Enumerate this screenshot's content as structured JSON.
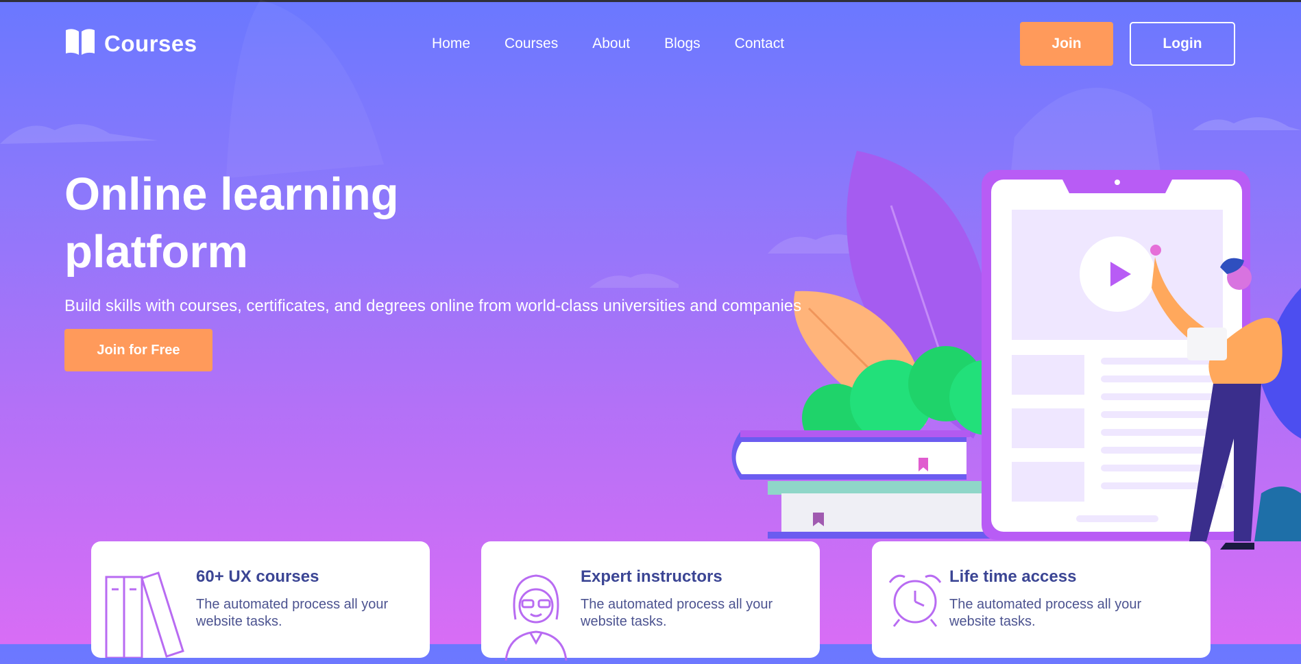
{
  "brand": {
    "name": "Courses",
    "icon": "open-book-icon"
  },
  "nav": {
    "items": [
      "Home",
      "Courses",
      "About",
      "Blogs",
      "Contact"
    ]
  },
  "header": {
    "join_label": "Join",
    "login_label": "Login"
  },
  "hero": {
    "title": "Online learning platform",
    "subtitle": "Build skills with courses, certificates, and degrees online from world-class universities and companies",
    "cta_label": "Join for Free"
  },
  "features": [
    {
      "icon": "books-icon",
      "title": "60+ UX courses",
      "description": "The automated process all your website tasks."
    },
    {
      "icon": "instructor-icon",
      "title": "Expert instructors",
      "description": "The automated process all your website tasks."
    },
    {
      "icon": "alarm-clock-icon",
      "title": "Life time access",
      "description": "The automated process all your website tasks."
    }
  ],
  "colors": {
    "accent": "#ff9a5b",
    "card_title": "#3b4594",
    "card_icon": "#b86bf2"
  }
}
